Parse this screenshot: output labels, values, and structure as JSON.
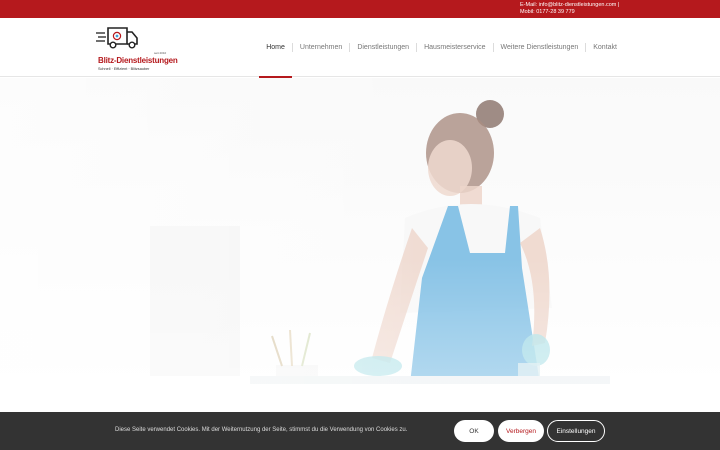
{
  "topbar": {
    "email": "E-Mail: info@blitz-dienstleistungen.com |",
    "phone": "Mobil: 0177-28 39 779"
  },
  "logo": {
    "name": "Blitz-Dienstleistungen",
    "sub": "Schnell · Effizient · Blitzsauber",
    "tagline": "seit 2010"
  },
  "nav": {
    "items": [
      {
        "label": "Home"
      },
      {
        "label": "Unternehmen"
      },
      {
        "label": "Dienstleistungen"
      },
      {
        "label": "Hausmeisterservice"
      },
      {
        "label": "Weitere Dienstleistungen"
      },
      {
        "label": "Kontakt"
      }
    ]
  },
  "colors": {
    "brand": "#b5191d",
    "cookie_bg": "#333333",
    "apron": "#3f9fd8"
  },
  "cookie": {
    "text": "Diese Seite verwendet Cookies. Mit der Weiternutzung der Seite, stimmst du die Verwendung von Cookies zu.",
    "ok": "OK",
    "hide": "Verbergen",
    "settings": "Einstellungen"
  }
}
